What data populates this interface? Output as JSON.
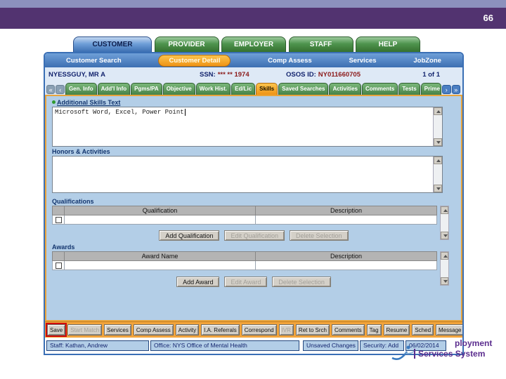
{
  "slide": {
    "page_number": "66"
  },
  "window": {
    "main_tabs": [
      "CUSTOMER",
      "PROVIDER",
      "EMPLOYER",
      "STAFF",
      "HELP"
    ],
    "nav_tabs": [
      "Customer Search",
      "Customer Detail",
      "Comp Assess",
      "Services",
      "JobZone"
    ],
    "customer_bar": {
      "name": "NYESSGUY, MR A",
      "ssn_label": "SSN:",
      "ssn_value": "*** ** 1974",
      "osos_label": "OSOS ID:",
      "osos_value": "NY011660705",
      "paging": "1 of 1"
    },
    "pager": {
      "first": "«",
      "prev": "‹",
      "next": "›",
      "last": "»"
    },
    "sub_tabs": [
      "Gen. Info",
      "Add'l Info",
      "Pgms/PA",
      "Objective",
      "Work Hist.",
      "Ed/Lic",
      "Skills",
      "Saved Searches",
      "Activities",
      "Comments",
      "Tests",
      "Prime"
    ],
    "active_sub_tab": "Skills",
    "skills": {
      "additional_label": "Additional Skills Text",
      "additional_value": "Microsoft Word, Excel, Power Point",
      "honors_label": "Honors & Activities",
      "honors_value": "",
      "qualifications_label": "Qualifications",
      "qual_columns": [
        "Qualification",
        "Description"
      ],
      "qual_rows": [
        {
          "qualification": "",
          "description": ""
        }
      ],
      "qual_buttons": [
        "Add Qualification",
        "Edit Qualification",
        "Delete Selection"
      ],
      "awards_label": "Awards",
      "award_columns": [
        "Award Name",
        "Description"
      ],
      "award_rows": [
        {
          "award_name": "",
          "description": ""
        }
      ],
      "award_buttons": [
        "Add Award",
        "Edit Award",
        "Delete Selection"
      ]
    },
    "toolbar": [
      "Save",
      "Start Match",
      "Services",
      "Comp Assess",
      "Activity",
      "I.A. Referrals",
      "Correspond",
      "IVR",
      "Ret to Srch",
      "Comments",
      "Tag",
      "Resume",
      "Sched",
      "Message"
    ],
    "status_bar": {
      "staff": "Staff: Kathan, Andrew",
      "office": "Office: NYS Office of Mental Health",
      "changes": "Unsaved Changes",
      "security": "Security: Add",
      "date": "06/02/2014"
    }
  },
  "logo": {
    "line1": "ployment",
    "line2": "Services System"
  },
  "colors": {
    "header_purple": "#523370",
    "header_lavender": "#8c91bd",
    "tab_green": "#478247",
    "tab_blue_active": "#3c6fb2",
    "active_orange": "#ef9416",
    "panel_blue": "#b3cee7",
    "panel_border_orange": "#e9a43b",
    "toolbar_orange": "#f2a43c",
    "save_highlight_red": "#cf0a0a",
    "value_red": "#8b1a1a",
    "logo_purple": "#5b2d8e"
  }
}
